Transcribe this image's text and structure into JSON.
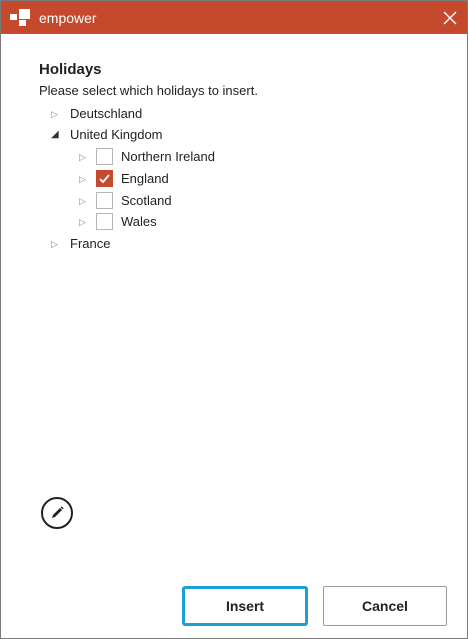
{
  "window": {
    "title": "empower",
    "accent_color": "#c5492d",
    "close_icon": "close-icon"
  },
  "dialog": {
    "heading": "Holidays",
    "instruction": "Please select which holidays to insert."
  },
  "tree": {
    "countries": [
      {
        "label": "Deutschland",
        "expanded": false
      },
      {
        "label": "United Kingdom",
        "expanded": true,
        "regions": [
          {
            "label": "Northern Ireland",
            "checked": false
          },
          {
            "label": "England",
            "checked": true
          },
          {
            "label": "Scotland",
            "checked": false
          },
          {
            "label": "Wales",
            "checked": false
          }
        ]
      },
      {
        "label": "France",
        "expanded": false
      }
    ]
  },
  "actions": {
    "edit_icon": "pencil-icon",
    "insert_label": "Insert",
    "cancel_label": "Cancel",
    "focus_color": "#1a9fd6"
  }
}
